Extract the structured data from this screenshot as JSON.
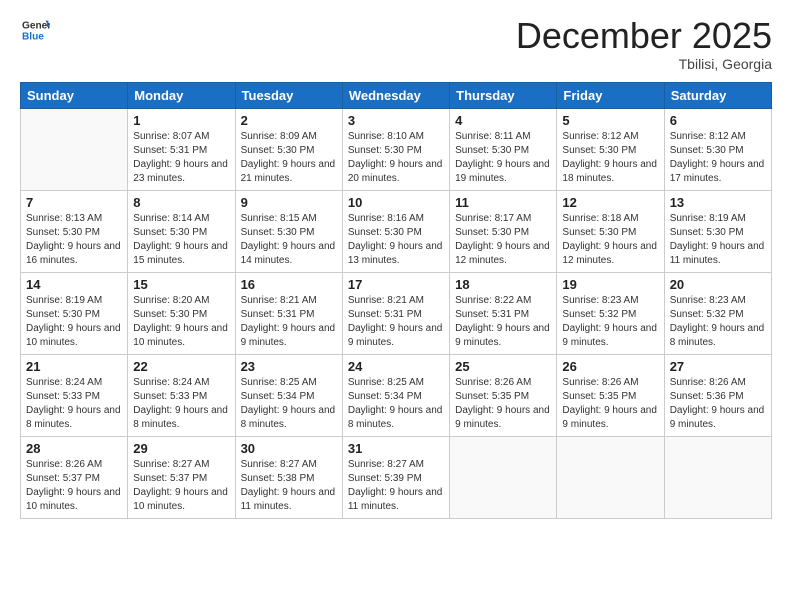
{
  "header": {
    "logo_general": "General",
    "logo_blue": "Blue",
    "month_title": "December 2025",
    "location": "Tbilisi, Georgia"
  },
  "weekdays": [
    "Sunday",
    "Monday",
    "Tuesday",
    "Wednesday",
    "Thursday",
    "Friday",
    "Saturday"
  ],
  "weeks": [
    [
      {
        "day": "",
        "sunrise": "",
        "sunset": "",
        "daylight": ""
      },
      {
        "day": "1",
        "sunrise": "Sunrise: 8:07 AM",
        "sunset": "Sunset: 5:31 PM",
        "daylight": "Daylight: 9 hours and 23 minutes."
      },
      {
        "day": "2",
        "sunrise": "Sunrise: 8:09 AM",
        "sunset": "Sunset: 5:30 PM",
        "daylight": "Daylight: 9 hours and 21 minutes."
      },
      {
        "day": "3",
        "sunrise": "Sunrise: 8:10 AM",
        "sunset": "Sunset: 5:30 PM",
        "daylight": "Daylight: 9 hours and 20 minutes."
      },
      {
        "day": "4",
        "sunrise": "Sunrise: 8:11 AM",
        "sunset": "Sunset: 5:30 PM",
        "daylight": "Daylight: 9 hours and 19 minutes."
      },
      {
        "day": "5",
        "sunrise": "Sunrise: 8:12 AM",
        "sunset": "Sunset: 5:30 PM",
        "daylight": "Daylight: 9 hours and 18 minutes."
      },
      {
        "day": "6",
        "sunrise": "Sunrise: 8:12 AM",
        "sunset": "Sunset: 5:30 PM",
        "daylight": "Daylight: 9 hours and 17 minutes."
      }
    ],
    [
      {
        "day": "7",
        "sunrise": "Sunrise: 8:13 AM",
        "sunset": "Sunset: 5:30 PM",
        "daylight": "Daylight: 9 hours and 16 minutes."
      },
      {
        "day": "8",
        "sunrise": "Sunrise: 8:14 AM",
        "sunset": "Sunset: 5:30 PM",
        "daylight": "Daylight: 9 hours and 15 minutes."
      },
      {
        "day": "9",
        "sunrise": "Sunrise: 8:15 AM",
        "sunset": "Sunset: 5:30 PM",
        "daylight": "Daylight: 9 hours and 14 minutes."
      },
      {
        "day": "10",
        "sunrise": "Sunrise: 8:16 AM",
        "sunset": "Sunset: 5:30 PM",
        "daylight": "Daylight: 9 hours and 13 minutes."
      },
      {
        "day": "11",
        "sunrise": "Sunrise: 8:17 AM",
        "sunset": "Sunset: 5:30 PM",
        "daylight": "Daylight: 9 hours and 12 minutes."
      },
      {
        "day": "12",
        "sunrise": "Sunrise: 8:18 AM",
        "sunset": "Sunset: 5:30 PM",
        "daylight": "Daylight: 9 hours and 12 minutes."
      },
      {
        "day": "13",
        "sunrise": "Sunrise: 8:19 AM",
        "sunset": "Sunset: 5:30 PM",
        "daylight": "Daylight: 9 hours and 11 minutes."
      }
    ],
    [
      {
        "day": "14",
        "sunrise": "Sunrise: 8:19 AM",
        "sunset": "Sunset: 5:30 PM",
        "daylight": "Daylight: 9 hours and 10 minutes."
      },
      {
        "day": "15",
        "sunrise": "Sunrise: 8:20 AM",
        "sunset": "Sunset: 5:30 PM",
        "daylight": "Daylight: 9 hours and 10 minutes."
      },
      {
        "day": "16",
        "sunrise": "Sunrise: 8:21 AM",
        "sunset": "Sunset: 5:31 PM",
        "daylight": "Daylight: 9 hours and 9 minutes."
      },
      {
        "day": "17",
        "sunrise": "Sunrise: 8:21 AM",
        "sunset": "Sunset: 5:31 PM",
        "daylight": "Daylight: 9 hours and 9 minutes."
      },
      {
        "day": "18",
        "sunrise": "Sunrise: 8:22 AM",
        "sunset": "Sunset: 5:31 PM",
        "daylight": "Daylight: 9 hours and 9 minutes."
      },
      {
        "day": "19",
        "sunrise": "Sunrise: 8:23 AM",
        "sunset": "Sunset: 5:32 PM",
        "daylight": "Daylight: 9 hours and 9 minutes."
      },
      {
        "day": "20",
        "sunrise": "Sunrise: 8:23 AM",
        "sunset": "Sunset: 5:32 PM",
        "daylight": "Daylight: 9 hours and 8 minutes."
      }
    ],
    [
      {
        "day": "21",
        "sunrise": "Sunrise: 8:24 AM",
        "sunset": "Sunset: 5:33 PM",
        "daylight": "Daylight: 9 hours and 8 minutes."
      },
      {
        "day": "22",
        "sunrise": "Sunrise: 8:24 AM",
        "sunset": "Sunset: 5:33 PM",
        "daylight": "Daylight: 9 hours and 8 minutes."
      },
      {
        "day": "23",
        "sunrise": "Sunrise: 8:25 AM",
        "sunset": "Sunset: 5:34 PM",
        "daylight": "Daylight: 9 hours and 8 minutes."
      },
      {
        "day": "24",
        "sunrise": "Sunrise: 8:25 AM",
        "sunset": "Sunset: 5:34 PM",
        "daylight": "Daylight: 9 hours and 8 minutes."
      },
      {
        "day": "25",
        "sunrise": "Sunrise: 8:26 AM",
        "sunset": "Sunset: 5:35 PM",
        "daylight": "Daylight: 9 hours and 9 minutes."
      },
      {
        "day": "26",
        "sunrise": "Sunrise: 8:26 AM",
        "sunset": "Sunset: 5:35 PM",
        "daylight": "Daylight: 9 hours and 9 minutes."
      },
      {
        "day": "27",
        "sunrise": "Sunrise: 8:26 AM",
        "sunset": "Sunset: 5:36 PM",
        "daylight": "Daylight: 9 hours and 9 minutes."
      }
    ],
    [
      {
        "day": "28",
        "sunrise": "Sunrise: 8:26 AM",
        "sunset": "Sunset: 5:37 PM",
        "daylight": "Daylight: 9 hours and 10 minutes."
      },
      {
        "day": "29",
        "sunrise": "Sunrise: 8:27 AM",
        "sunset": "Sunset: 5:37 PM",
        "daylight": "Daylight: 9 hours and 10 minutes."
      },
      {
        "day": "30",
        "sunrise": "Sunrise: 8:27 AM",
        "sunset": "Sunset: 5:38 PM",
        "daylight": "Daylight: 9 hours and 11 minutes."
      },
      {
        "day": "31",
        "sunrise": "Sunrise: 8:27 AM",
        "sunset": "Sunset: 5:39 PM",
        "daylight": "Daylight: 9 hours and 11 minutes."
      },
      {
        "day": "",
        "sunrise": "",
        "sunset": "",
        "daylight": ""
      },
      {
        "day": "",
        "sunrise": "",
        "sunset": "",
        "daylight": ""
      },
      {
        "day": "",
        "sunrise": "",
        "sunset": "",
        "daylight": ""
      }
    ]
  ]
}
